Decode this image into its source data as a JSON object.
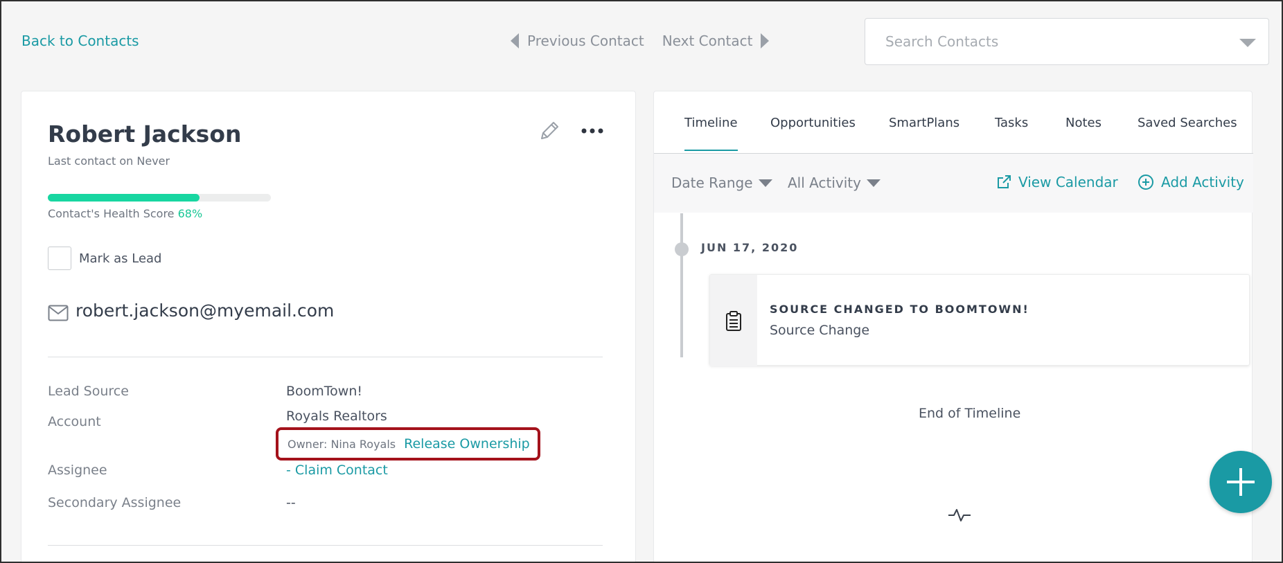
{
  "topbar": {
    "back_label": "Back to Contacts",
    "prev_label": "Previous Contact",
    "next_label": "Next Contact",
    "search_placeholder": "Search Contacts"
  },
  "contact": {
    "name": "Robert Jackson",
    "last_contact": "Last contact on Never",
    "health_label": "Contact's Health Score",
    "health_score_text": "68%",
    "health_score": 0.68,
    "mark_as_lead_label": "Mark as Lead",
    "email": "robert.jackson@myemail.com",
    "fields": {
      "lead_source_label": "Lead Source",
      "lead_source_value": "BoomTown!",
      "account_label": "Account",
      "account_value": "Royals Realtors",
      "owner_text": "Owner: Nina Royals",
      "release_ownership": "Release Ownership",
      "assignee_label": "Assignee",
      "assignee_value": "- Claim Contact",
      "secondary_assignee_label": "Secondary Assignee",
      "secondary_assignee_value": "--"
    }
  },
  "tabs": [
    {
      "label": "Timeline",
      "active": true
    },
    {
      "label": "Opportunities",
      "active": false
    },
    {
      "label": "SmartPlans",
      "active": false
    },
    {
      "label": "Tasks",
      "active": false
    },
    {
      "label": "Notes",
      "active": false
    },
    {
      "label": "Saved Searches",
      "active": false
    }
  ],
  "filters": {
    "date_range": "Date Range",
    "all_activity": "All Activity",
    "view_calendar": "View Calendar",
    "add_activity": "Add Activity"
  },
  "timeline": {
    "date": "JUN 17, 2020",
    "event_title": "SOURCE CHANGED TO BOOMTOWN!",
    "event_subtitle": "Source Change",
    "end_label": "End of Timeline"
  },
  "colors": {
    "accent": "#1a9aa4",
    "health": "#18d6a1",
    "highlight_border": "#a4121b"
  }
}
